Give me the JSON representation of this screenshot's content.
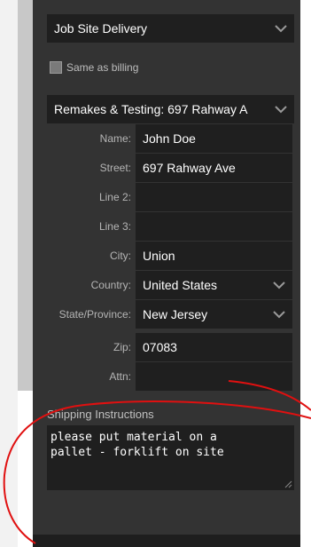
{
  "delivery": {
    "selected": "Job Site Delivery"
  },
  "same_as_billing": {
    "label": "Same as billing",
    "checked": false
  },
  "address_book": {
    "selected": "Remakes & Testing: 697 Rahway A"
  },
  "fields": {
    "name": {
      "label": "Name:",
      "value": "John Doe"
    },
    "street": {
      "label": "Street:",
      "value": "697 Rahway Ave"
    },
    "line2": {
      "label": "Line 2:",
      "value": ""
    },
    "line3": {
      "label": "Line 3:",
      "value": ""
    },
    "city": {
      "label": "City:",
      "value": "Union"
    },
    "country": {
      "label": "Country:",
      "value": "United States"
    },
    "state": {
      "label": "State/Province:",
      "value": "New Jersey"
    },
    "zip": {
      "label": "Zip:",
      "value": "07083"
    },
    "attn": {
      "label": "Attn:",
      "value": ""
    }
  },
  "shipping_instructions": {
    "label": "Shipping Instructions",
    "value": "please put material on a\npallet - forklift on site"
  },
  "icons": {
    "select_arrow": "chevron-down-icon",
    "resize": "resize-grip-icon"
  },
  "colors": {
    "panel": "#333333",
    "field": "#1f1f1f",
    "annotation": "#e01010"
  }
}
